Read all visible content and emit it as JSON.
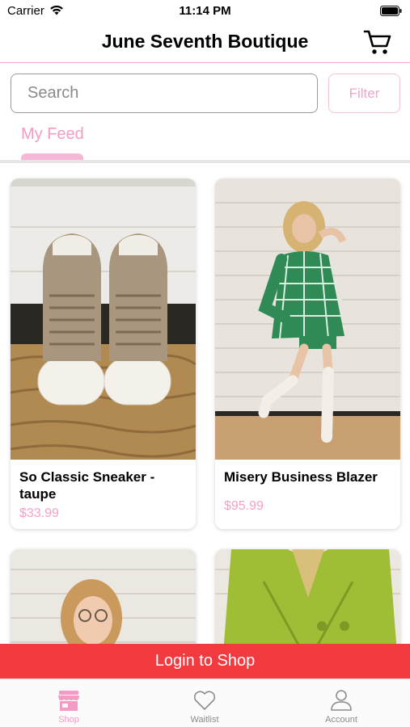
{
  "status_bar": {
    "carrier": "Carrier",
    "time": "11:14 PM"
  },
  "header": {
    "title": "June Seventh Boutique",
    "cart_icon": "shopping-cart-icon"
  },
  "search": {
    "placeholder": "Search",
    "value": "",
    "filter_label": "Filter"
  },
  "tabs": [
    {
      "label": "My Feed",
      "active": true
    }
  ],
  "products": [
    {
      "name_line1": "So Classic Sneaker -",
      "name_line2": "taupe",
      "price": "$33.99"
    },
    {
      "name_line1": "Misery Business Blazer",
      "name_line2": "",
      "price": "$95.99"
    }
  ],
  "login_banner": "Login to Shop",
  "tab_bar": [
    {
      "label": "Shop",
      "icon": "storefront-icon",
      "active": true
    },
    {
      "label": "Waitlist",
      "icon": "heart-icon",
      "active": false
    },
    {
      "label": "Account",
      "icon": "person-icon",
      "active": false
    }
  ],
  "colors": {
    "accent_pink": "#f39bc4",
    "banner_red": "#f23a3f",
    "divider_pink": "#f3a6cf"
  }
}
